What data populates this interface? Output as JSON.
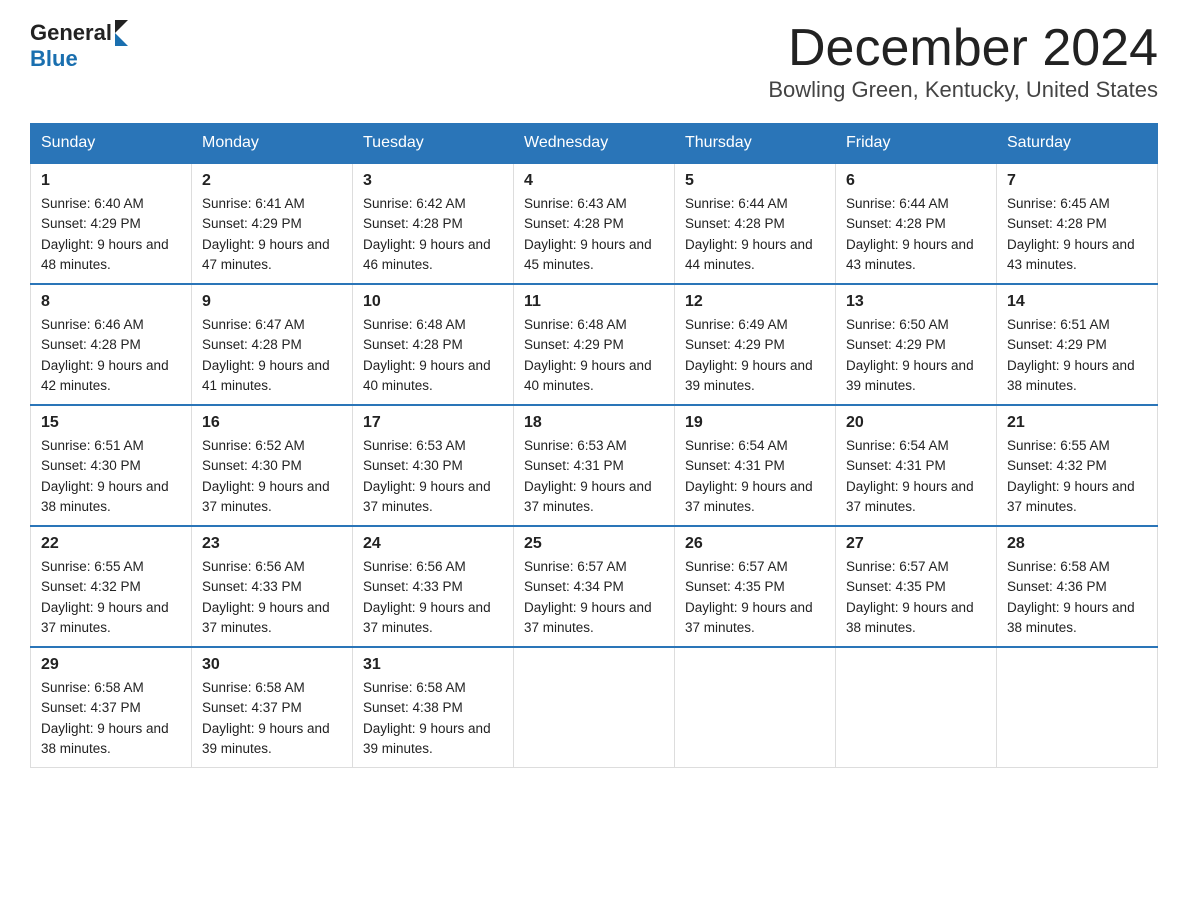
{
  "header": {
    "logo_general": "General",
    "logo_blue": "Blue",
    "title": "December 2024",
    "subtitle": "Bowling Green, Kentucky, United States"
  },
  "weekdays": [
    "Sunday",
    "Monday",
    "Tuesday",
    "Wednesday",
    "Thursday",
    "Friday",
    "Saturday"
  ],
  "weeks": [
    [
      {
        "day": "1",
        "sunrise": "6:40 AM",
        "sunset": "4:29 PM",
        "daylight": "9 hours and 48 minutes."
      },
      {
        "day": "2",
        "sunrise": "6:41 AM",
        "sunset": "4:29 PM",
        "daylight": "9 hours and 47 minutes."
      },
      {
        "day": "3",
        "sunrise": "6:42 AM",
        "sunset": "4:28 PM",
        "daylight": "9 hours and 46 minutes."
      },
      {
        "day": "4",
        "sunrise": "6:43 AM",
        "sunset": "4:28 PM",
        "daylight": "9 hours and 45 minutes."
      },
      {
        "day": "5",
        "sunrise": "6:44 AM",
        "sunset": "4:28 PM",
        "daylight": "9 hours and 44 minutes."
      },
      {
        "day": "6",
        "sunrise": "6:44 AM",
        "sunset": "4:28 PM",
        "daylight": "9 hours and 43 minutes."
      },
      {
        "day": "7",
        "sunrise": "6:45 AM",
        "sunset": "4:28 PM",
        "daylight": "9 hours and 43 minutes."
      }
    ],
    [
      {
        "day": "8",
        "sunrise": "6:46 AM",
        "sunset": "4:28 PM",
        "daylight": "9 hours and 42 minutes."
      },
      {
        "day": "9",
        "sunrise": "6:47 AM",
        "sunset": "4:28 PM",
        "daylight": "9 hours and 41 minutes."
      },
      {
        "day": "10",
        "sunrise": "6:48 AM",
        "sunset": "4:28 PM",
        "daylight": "9 hours and 40 minutes."
      },
      {
        "day": "11",
        "sunrise": "6:48 AM",
        "sunset": "4:29 PM",
        "daylight": "9 hours and 40 minutes."
      },
      {
        "day": "12",
        "sunrise": "6:49 AM",
        "sunset": "4:29 PM",
        "daylight": "9 hours and 39 minutes."
      },
      {
        "day": "13",
        "sunrise": "6:50 AM",
        "sunset": "4:29 PM",
        "daylight": "9 hours and 39 minutes."
      },
      {
        "day": "14",
        "sunrise": "6:51 AM",
        "sunset": "4:29 PM",
        "daylight": "9 hours and 38 minutes."
      }
    ],
    [
      {
        "day": "15",
        "sunrise": "6:51 AM",
        "sunset": "4:30 PM",
        "daylight": "9 hours and 38 minutes."
      },
      {
        "day": "16",
        "sunrise": "6:52 AM",
        "sunset": "4:30 PM",
        "daylight": "9 hours and 37 minutes."
      },
      {
        "day": "17",
        "sunrise": "6:53 AM",
        "sunset": "4:30 PM",
        "daylight": "9 hours and 37 minutes."
      },
      {
        "day": "18",
        "sunrise": "6:53 AM",
        "sunset": "4:31 PM",
        "daylight": "9 hours and 37 minutes."
      },
      {
        "day": "19",
        "sunrise": "6:54 AM",
        "sunset": "4:31 PM",
        "daylight": "9 hours and 37 minutes."
      },
      {
        "day": "20",
        "sunrise": "6:54 AM",
        "sunset": "4:31 PM",
        "daylight": "9 hours and 37 minutes."
      },
      {
        "day": "21",
        "sunrise": "6:55 AM",
        "sunset": "4:32 PM",
        "daylight": "9 hours and 37 minutes."
      }
    ],
    [
      {
        "day": "22",
        "sunrise": "6:55 AM",
        "sunset": "4:32 PM",
        "daylight": "9 hours and 37 minutes."
      },
      {
        "day": "23",
        "sunrise": "6:56 AM",
        "sunset": "4:33 PM",
        "daylight": "9 hours and 37 minutes."
      },
      {
        "day": "24",
        "sunrise": "6:56 AM",
        "sunset": "4:33 PM",
        "daylight": "9 hours and 37 minutes."
      },
      {
        "day": "25",
        "sunrise": "6:57 AM",
        "sunset": "4:34 PM",
        "daylight": "9 hours and 37 minutes."
      },
      {
        "day": "26",
        "sunrise": "6:57 AM",
        "sunset": "4:35 PM",
        "daylight": "9 hours and 37 minutes."
      },
      {
        "day": "27",
        "sunrise": "6:57 AM",
        "sunset": "4:35 PM",
        "daylight": "9 hours and 38 minutes."
      },
      {
        "day": "28",
        "sunrise": "6:58 AM",
        "sunset": "4:36 PM",
        "daylight": "9 hours and 38 minutes."
      }
    ],
    [
      {
        "day": "29",
        "sunrise": "6:58 AM",
        "sunset": "4:37 PM",
        "daylight": "9 hours and 38 minutes."
      },
      {
        "day": "30",
        "sunrise": "6:58 AM",
        "sunset": "4:37 PM",
        "daylight": "9 hours and 39 minutes."
      },
      {
        "day": "31",
        "sunrise": "6:58 AM",
        "sunset": "4:38 PM",
        "daylight": "9 hours and 39 minutes."
      },
      null,
      null,
      null,
      null
    ]
  ]
}
